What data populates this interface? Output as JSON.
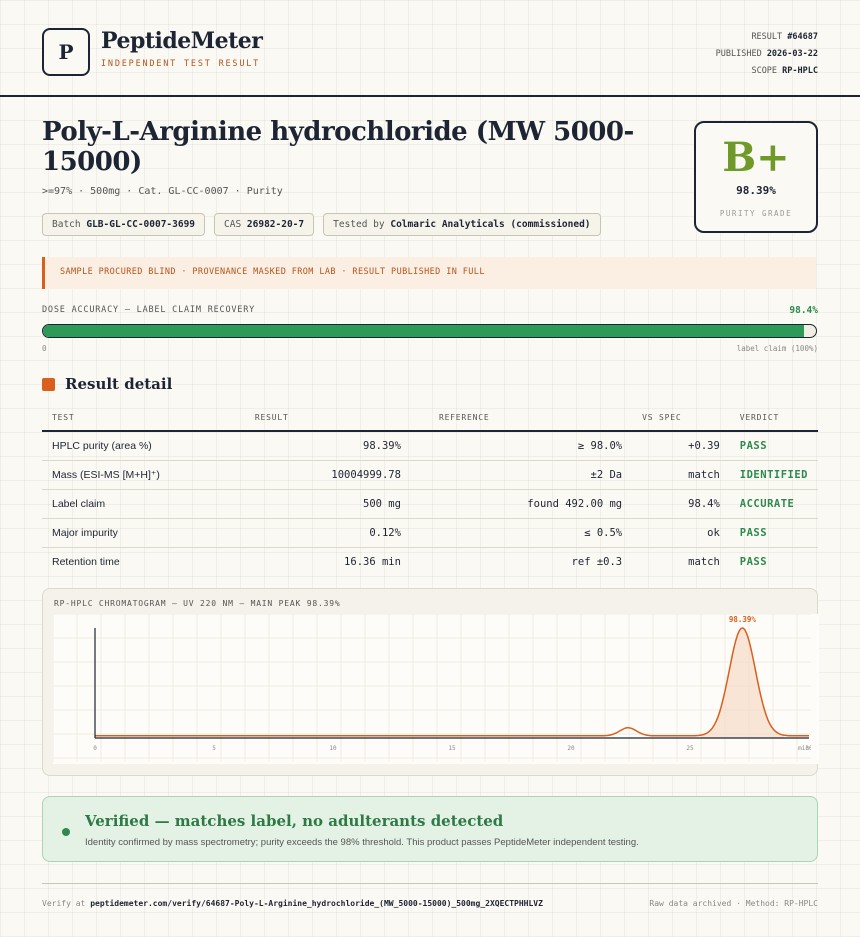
{
  "header": {
    "logo_letter": "P",
    "brand": "PeptideMeter",
    "tagline": "INDEPENDENT TEST RESULT",
    "result_label": "RESULT",
    "result_id": "#64687",
    "published_label": "PUBLISHED",
    "published_date": "2026-03-22",
    "scope_label": "SCOPE",
    "scope_value": "RP-HPLC"
  },
  "product": {
    "title": "Poly-L-Arginine hydrochloride (MW 5000-15000)",
    "subtitle": ">=97% · 500mg · Cat. GL-CC-0007 · Purity",
    "batch_label": "Batch",
    "batch_value": "GLB-GL-CC-0007-3699",
    "cas_label": "CAS",
    "cas_value": "26982-20-7",
    "tested_label": "Tested by",
    "tested_value": "Colmaric Analyticals (commissioned)"
  },
  "grade": {
    "letter": "B+",
    "value": "98.39%",
    "label": "PURITY GRADE",
    "color": "#6f9a2a"
  },
  "notice": "SAMPLE PROCURED BLIND · PROVENANCE MASKED FROM LAB · RESULT PUBLISHED IN FULL",
  "dose": {
    "label": "DOSE ACCURACY — LABEL CLAIM RECOVERY",
    "value_text": "98.4%",
    "fraction": 0.984,
    "min_label": "0",
    "max_label": "label claim (100%)"
  },
  "section_title": "Result detail",
  "table": {
    "headers": [
      "TEST",
      "RESULT",
      "REFERENCE",
      "VS SPEC",
      "VERDICT"
    ],
    "rows": [
      {
        "test": "HPLC purity (area %)",
        "result": "98.39%",
        "reference": "≥ 98.0%",
        "vs": "+0.39",
        "verdict": "PASS"
      },
      {
        "test": "Mass (ESI-MS [M+H]⁺)",
        "result": "10004999.78",
        "reference": "±2 Da",
        "vs": "match",
        "verdict": "IDENTIFIED"
      },
      {
        "test": "Label claim",
        "result": "500 mg",
        "reference": "found 492.00 mg",
        "vs": "98.4%",
        "verdict": "ACCURATE"
      },
      {
        "test": "Major impurity",
        "result": "0.12%",
        "reference": "≤ 0.5%",
        "vs": "ok",
        "verdict": "PASS"
      },
      {
        "test": "Retention time",
        "result": "16.36 min",
        "reference": "ref ±0.3",
        "vs": "match",
        "verdict": "PASS"
      }
    ]
  },
  "chart_data": {
    "type": "line",
    "title": "RP-HPLC CHROMATOGRAM — UV 220 NM — MAIN PEAK 98.39%",
    "xlabel": "",
    "ylabel": "",
    "xlim": [
      0,
      30
    ],
    "ylim": [
      0,
      1
    ],
    "x_ticks": [
      0,
      5,
      10,
      15,
      20,
      25,
      30
    ],
    "x_tick_labels": [
      "0",
      "5",
      "10",
      "15",
      "20",
      "25",
      "30"
    ],
    "end_label": "min",
    "peaks": [
      {
        "rt": 22.4,
        "height": 0.075,
        "width": 0.35
      },
      {
        "rt": 27.2,
        "height": 1.0,
        "width": 0.55,
        "label": "98.39%"
      }
    ],
    "baseline": 0.02,
    "line_color": "#d9601c",
    "grid": true
  },
  "verified": {
    "title": "Verified — matches label, no adulterants detected",
    "subtitle": "Identity confirmed by mass spectrometry; purity exceeds the 98% threshold. This product passes PeptideMeter independent testing."
  },
  "footer": {
    "verify_label": "Verify at",
    "verify_url": "peptidemeter.com/verify/64687-Poly-L-Arginine_hydrochloride_(MW_5000-15000)_500mg_2XQECTPHHLVZ",
    "right_text": "Raw data archived · Method: RP-HPLC"
  }
}
